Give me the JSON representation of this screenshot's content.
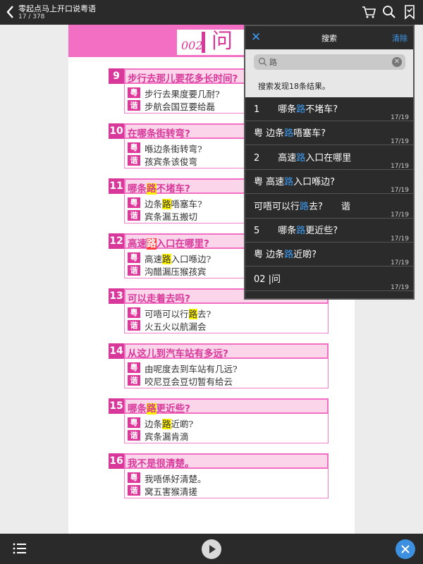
{
  "topbar": {
    "title": "零起点马上开口说粤语",
    "page_info": "17 / 378",
    "icons": [
      "back-icon",
      "cart-icon",
      "search-icon",
      "bookmark-icon"
    ]
  },
  "page": {
    "header_num": "002",
    "header_text": "问",
    "items": [
      {
        "num": "9",
        "q_pre": "步行去那儿要花多长时间?",
        "q_kw": "",
        "q_post": "",
        "hl": "",
        "yue": "步行去果度要几耐?",
        "yue_pre": "步行去果度要几耐?",
        "yue_kw": "",
        "yue_post": "",
        "xie": "步航会国豆要给磊"
      },
      {
        "num": "10",
        "q_pre": "在哪条街转弯?",
        "q_kw": "",
        "q_post": "",
        "hl": "",
        "yue_pre": "喺边条街转弯?",
        "yue_kw": "",
        "yue_post": "",
        "xie": "孩宾条该俊弯"
      },
      {
        "num": "11",
        "q_pre": "哪条",
        "q_kw": "路",
        "q_post": "不堵车?",
        "hl": "yellow",
        "yue_pre": "边条",
        "yue_kw": "路",
        "yue_post": "唔塞车?",
        "xie": "宾条漏五搬切"
      },
      {
        "num": "12",
        "q_pre": "高速",
        "q_kw": "路",
        "q_post": "入口在哪里?",
        "hl": "red",
        "yue_pre": "高速",
        "yue_kw": "路",
        "yue_post": "入口喺边?",
        "xie": "沟醋漏压猴孩宾"
      },
      {
        "num": "13",
        "q_pre": "可以走着去吗?",
        "q_kw": "",
        "q_post": "",
        "hl": "",
        "yue_pre": "可唔可以行",
        "yue_kw": "路",
        "yue_post": "去?",
        "xie": "火五火以航漏会"
      },
      {
        "num": "14",
        "q_pre": "从这儿到汽车站有多远?",
        "q_kw": "",
        "q_post": "",
        "hl": "",
        "yue_pre": "由呢度去到车站有几远?",
        "yue_kw": "",
        "yue_post": "",
        "xie": "咬尼豆会豆切暂有给云"
      },
      {
        "num": "15",
        "q_pre": "哪条",
        "q_kw": "路",
        "q_post": "更近些?",
        "hl": "yellow",
        "yue_pre": "边条",
        "yue_kw": "路",
        "yue_post": "近啲?",
        "xie": "宾条漏肯滴"
      },
      {
        "num": "16",
        "q_pre": "我不是很清楚。",
        "q_kw": "",
        "q_post": "",
        "hl": "",
        "yue_pre": "我唔係好清楚。",
        "yue_kw": "",
        "yue_post": "",
        "xie": "窝五害猴清搓"
      }
    ],
    "tag_yue": "粤",
    "tag_xie": "谐"
  },
  "search": {
    "title": "搜索",
    "clear_label": "清除",
    "query": "路",
    "result_count": "搜索发现18条结果。",
    "results": [
      {
        "pre": "1　　哪条",
        "kw": "路",
        "post": "不堵车?",
        "page": "17/19"
      },
      {
        "pre": "粤 边条",
        "kw": "路",
        "post": "唔塞车?",
        "page": "17/19"
      },
      {
        "pre": "2　　高速",
        "kw": "路",
        "post": "入口在哪里",
        "page": "17/19"
      },
      {
        "pre": "粤 高速",
        "kw": "路",
        "post": "入口喺边?",
        "page": "17/19"
      },
      {
        "pre": "可唔可以行",
        "kw": "路",
        "post": "去?　　谐",
        "page": "17/19"
      },
      {
        "pre": "5　　哪条",
        "kw": "路",
        "post": "更近些?",
        "page": "17/19"
      },
      {
        "pre": "粤 边条",
        "kw": "路",
        "post": "近啲?",
        "page": "17/19"
      },
      {
        "pre": "02 |问",
        "kw": "",
        "post": "",
        "page": "17/19"
      }
    ]
  },
  "colors": {
    "accent_pink": "#d8389a",
    "highlight": "#fff200",
    "keyword_blue": "#3d9bf0"
  }
}
